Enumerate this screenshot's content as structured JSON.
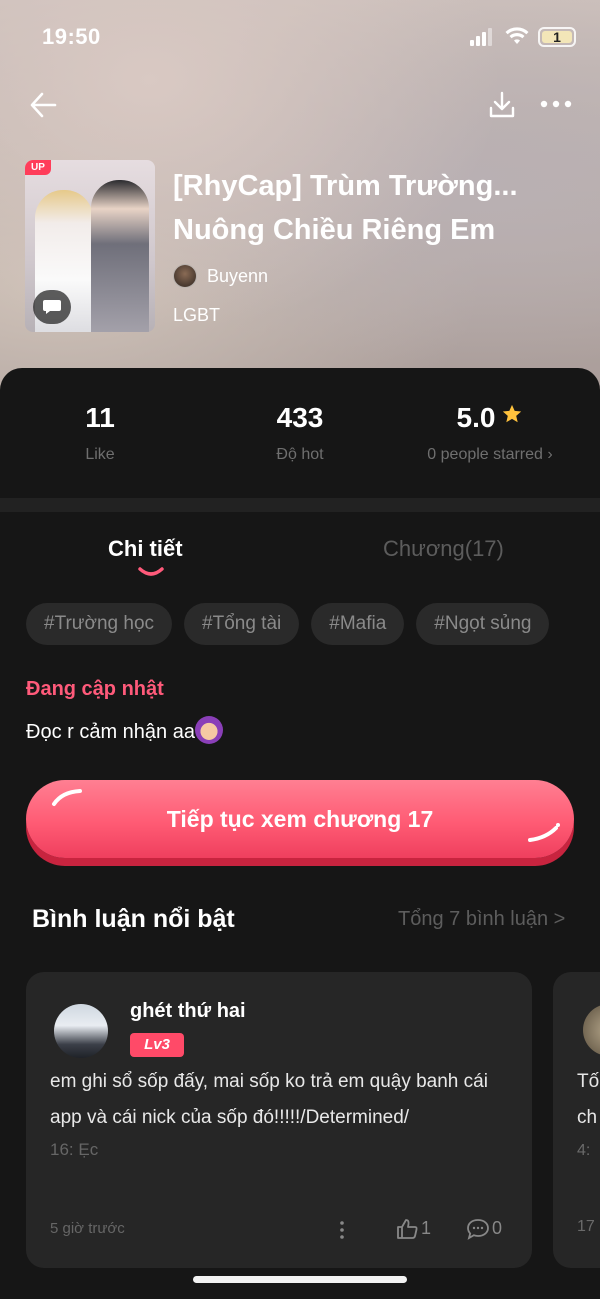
{
  "status_bar": {
    "time": "19:50",
    "battery": "1"
  },
  "story": {
    "cover_badge": "UP",
    "title": "[RhyCap] Trùm Trường... Nuông Chiều Riêng Em",
    "author": "Buyenn",
    "genre": "LGBT"
  },
  "stats": [
    {
      "value": "11",
      "label": "Like"
    },
    {
      "value": "433",
      "label": "Độ hot"
    },
    {
      "value": "5.0",
      "label": "0 people starred ›"
    }
  ],
  "tabs": {
    "detail": "Chi tiết",
    "chapters": "Chương(17)"
  },
  "tags": [
    "#Trường học",
    "#Tổng tài",
    "#Mafia",
    "#Ngọt sủng"
  ],
  "status_label": "Đang cập nhật",
  "description": "Đọc r cảm nhận aa",
  "continue_button": "Tiếp tục xem chương 17",
  "comments": {
    "title": "Bình luận nổi bật",
    "total": "Tổng 7 bình luận >",
    "items": [
      {
        "user": "ghét thứ hai",
        "level": "Lv3",
        "text": "em ghi sổ sốp đấy, mai sốp ko trả em quậy banh cái app và cái nick của sốp đó!!!!!/Determined/",
        "chapter": "16: Ẹc",
        "time": "5 giờ trước",
        "likes": "1",
        "replies": "0"
      },
      {
        "text_line1": "Tố",
        "text_line2": "ch",
        "chapter": "4:",
        "time": "17"
      }
    ]
  },
  "colors": {
    "accent": "#ff5a7a",
    "button": "#ff5b74",
    "star": "#ffc23d",
    "panel": "#161616"
  }
}
